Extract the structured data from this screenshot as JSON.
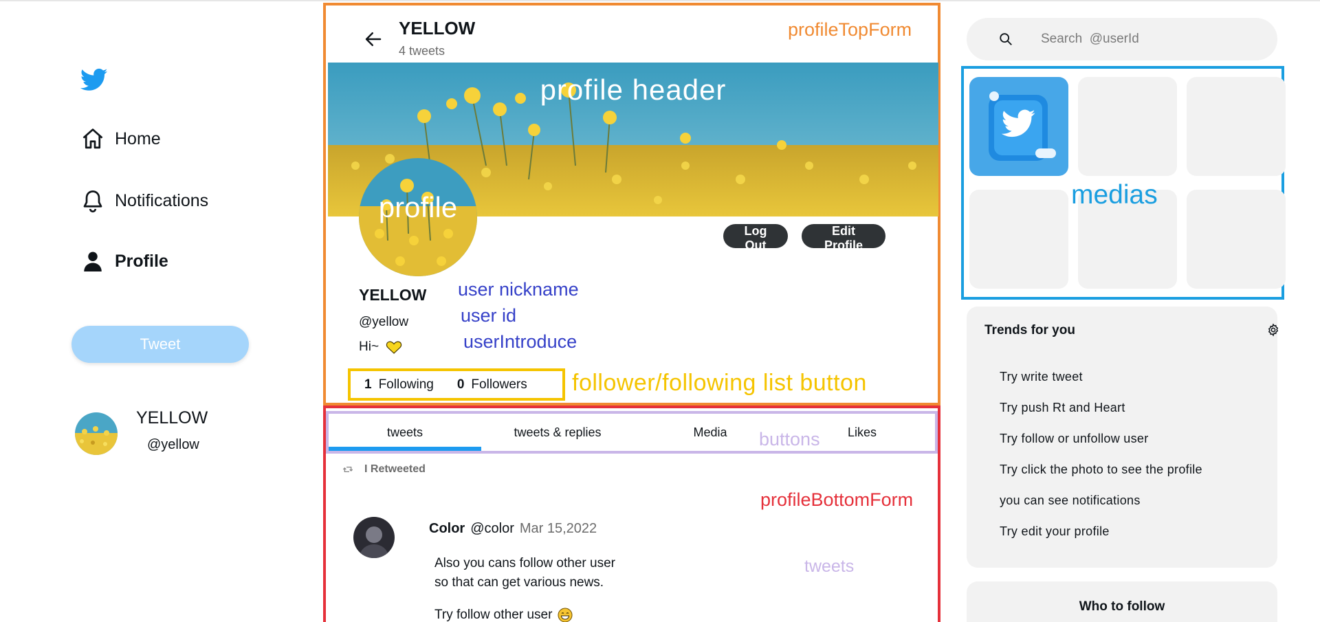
{
  "sidebar": {
    "nav": {
      "home": "Home",
      "notifications": "Notifications",
      "profile": "Profile"
    },
    "tweet_button": "Tweet",
    "current_user": {
      "name": "YELLOW",
      "id": "@yellow"
    }
  },
  "profile_top": {
    "title": "YELLOW",
    "tweet_count": "4 tweets",
    "annotation": "profileTopForm",
    "header_annotation": "profile header",
    "avatar_annotation": "profile",
    "logout_label": "Log Out",
    "edit_label": "Edit Profile",
    "nickname": "YELLOW",
    "user_id": "@yellow",
    "introduce": "Hi~",
    "ann_nickname": "user nickname",
    "ann_user_id": "user id",
    "ann_introduce": "userIntroduce",
    "following_count": "1",
    "following_label": "Following",
    "followers_count": "0",
    "followers_label": "Followers",
    "ann_follow": "follower/following list button"
  },
  "profile_bottom": {
    "annotation": "profileBottomForm",
    "ann_buttons": "buttons",
    "ann_tweets": "tweets",
    "tabs": [
      "tweets",
      "tweets & replies",
      "Media",
      "Likes"
    ],
    "active_tab": 0,
    "retweeted_label": "I Retweeted",
    "tweet": {
      "author": "Color",
      "handle": "@color",
      "date": "Mar 15,2022",
      "body": "Also you cans follow other user\nso that can get various news.",
      "last_line": "Try follow other user"
    }
  },
  "right": {
    "search_placeholder": "Search  @userId",
    "ann_medias": "medias",
    "trends_title": "Trends for you",
    "trends": [
      "Try write tweet",
      "Try push Rt and Heart",
      "Try follow or unfollow user",
      "Try click the photo to see the profile",
      "you can see notifications",
      "Try edit your profile"
    ],
    "who_to_follow": "Who to follow"
  },
  "colors": {
    "twitter_blue": "#1d9bf0",
    "orange_annotation": "#f08a32",
    "red_annotation": "#e5303a",
    "yellow_annotation": "#f5c400",
    "purple_annotation": "#c9b6e8",
    "blue_annotation": "#3540c8",
    "media_annotation": "#1a9ee0"
  },
  "icons": [
    "twitter-logo-icon",
    "home-icon",
    "bell-icon",
    "person-icon",
    "back-arrow-icon",
    "heart-emoji-icon",
    "retweet-icon",
    "grin-emoji-icon",
    "search-icon",
    "gear-icon"
  ]
}
